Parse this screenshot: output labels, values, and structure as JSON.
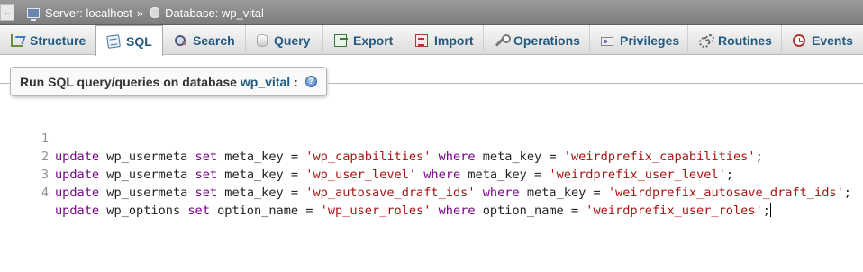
{
  "breadcrumb": {
    "server_label": "Server: localhost",
    "separator": "»",
    "database_label": "Database: wp_vital"
  },
  "tabs": [
    {
      "label": "Structure",
      "icon": "structure-icon",
      "active": false
    },
    {
      "label": "SQL",
      "icon": "sql-icon",
      "active": true
    },
    {
      "label": "Search",
      "icon": "search-icon",
      "active": false
    },
    {
      "label": "Query",
      "icon": "query-icon",
      "active": false
    },
    {
      "label": "Export",
      "icon": "export-icon",
      "active": false
    },
    {
      "label": "Import",
      "icon": "import-icon",
      "active": false
    },
    {
      "label": "Operations",
      "icon": "wrench-icon",
      "active": false
    },
    {
      "label": "Privileges",
      "icon": "privileges-icon",
      "active": false
    },
    {
      "label": "Routines",
      "icon": "routines-icon",
      "active": false
    },
    {
      "label": "Events",
      "icon": "clock-icon",
      "active": false
    }
  ],
  "sql_panel": {
    "legend_prefix": "Run SQL query/queries on database",
    "database_name": "wp_vital",
    "legend_suffix": ":",
    "help_icon": "help-icon"
  },
  "editor": {
    "line_numbers": [
      "1",
      "2",
      "3",
      "4"
    ],
    "lines": [
      {
        "t1": "update",
        "t2": " wp_usermeta ",
        "t3": "set",
        "t4": " meta_key = ",
        "t5": "'wp_capabilities'",
        "t6": " ",
        "t7": "where",
        "t8": " meta_key = ",
        "t9": "'weirdprefix_capabilities'",
        "t10": ";"
      },
      {
        "t1": "update",
        "t2": " wp_usermeta ",
        "t3": "set",
        "t4": " meta_key = ",
        "t5": "'wp_user_level'",
        "t6": " ",
        "t7": "where",
        "t8": " meta_key = ",
        "t9": "'weirdprefix_user_level'",
        "t10": ";"
      },
      {
        "t1": "update",
        "t2": " wp_usermeta ",
        "t3": "set",
        "t4": " meta_key = ",
        "t5": "'wp_autosave_draft_ids'",
        "t6": " ",
        "t7": "where",
        "t8": " meta_key = ",
        "t9": "'weirdprefix_autosave_draft_ids'",
        "t10": ";"
      },
      {
        "t1": "update",
        "t2": " wp_options ",
        "t3": "set",
        "t4": " option_name = ",
        "t5": "'wp_user_roles'",
        "t6": " ",
        "t7": "where",
        "t8": " option_name = ",
        "t9": "'weirdprefix_user_roles'",
        "t10": ";"
      }
    ]
  },
  "colors": {
    "tab_text": "#235a81",
    "keyword": "#770088",
    "string": "#aa1111"
  }
}
